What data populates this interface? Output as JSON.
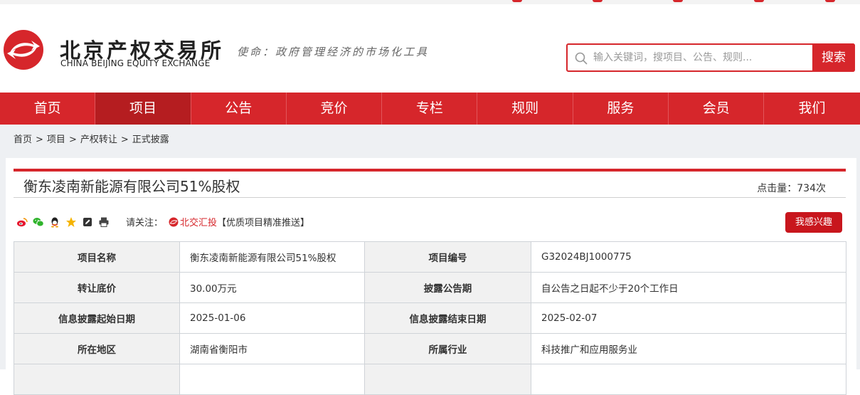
{
  "header": {
    "logo_cn": "北京产权交易所",
    "logo_en": "CHINA BEIJING EQUITY EXCHANGE",
    "slogan": "使命：政府管理经济的市场化工具",
    "search_placeholder": "输入关键词，搜项目、公告、规则...",
    "search_button": "搜索"
  },
  "nav": {
    "items": [
      "首页",
      "项目",
      "公告",
      "竞价",
      "专栏",
      "规则",
      "服务",
      "会员",
      "我们"
    ],
    "active": "项目"
  },
  "breadcrumb": [
    "首页",
    "项目",
    "产权转让",
    "正式披露"
  ],
  "breadcrumb_separator": ">",
  "project": {
    "title": "衡东凌南新能源有限公司51%股权",
    "clicks": "点击量：734次"
  },
  "share": {
    "icons": [
      "weibo-icon",
      "wechat-icon",
      "qq-icon",
      "favorite-star-icon",
      "edit-icon",
      "print-icon"
    ],
    "follow_label": "请关注：",
    "bj_link": "北交汇投",
    "bj_suffix": "【优质项目精准推送】",
    "interest_button": "我感兴趣"
  },
  "info_table": {
    "rows": [
      [
        "项目名称",
        "衡东凌南新能源有限公司51%股权",
        "项目编号",
        "G32024BJ1000775"
      ],
      [
        "转让底价",
        "30.00万元",
        "披露公告期",
        "自公告之日起不少于20个工作日"
      ],
      [
        "信息披露起始日期",
        "2025-01-06",
        "信息披露结束日期",
        "2025-02-07"
      ],
      [
        "所在地区",
        "湖南省衡阳市",
        "所属行业",
        "科技推广和应用服务业"
      ]
    ]
  },
  "colors": {
    "brand_red": "#d6262b",
    "nav_active": "#b51d20",
    "page_bg": "#eef0f3"
  }
}
